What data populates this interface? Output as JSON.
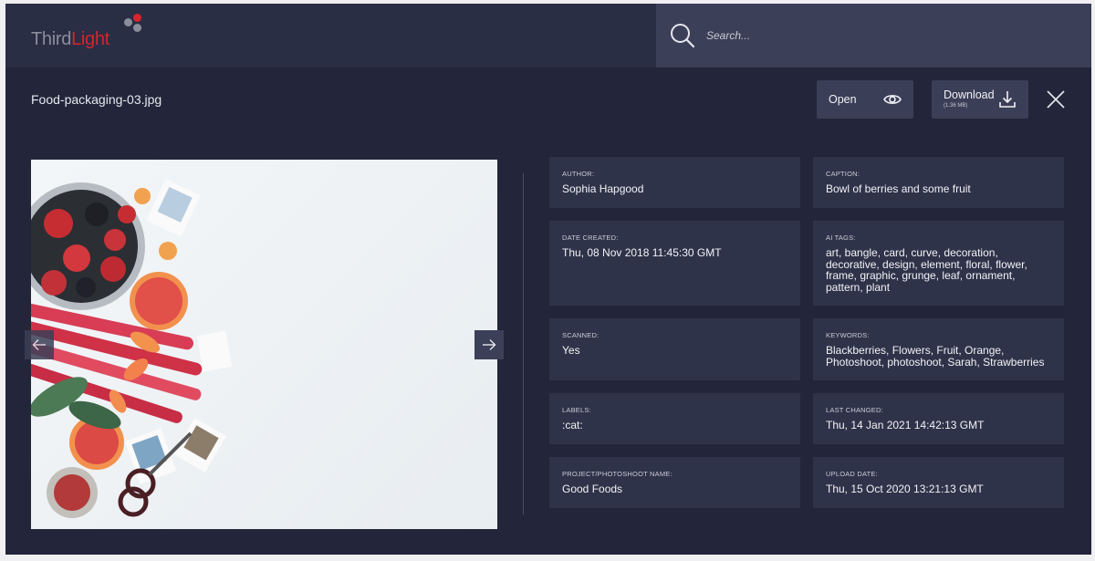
{
  "brand": {
    "logo_part1": "Third",
    "logo_part2": "Light",
    "colors": {
      "accent_red": "#d8242c",
      "dot_gray": "#8a8d9c"
    }
  },
  "search": {
    "placeholder": "Search...",
    "value": ""
  },
  "file": {
    "title": "Food-packaging-03.jpg",
    "open_label": "Open",
    "download_label": "Download",
    "download_size": "(1.36 MB)"
  },
  "icons": {
    "search": "search-icon",
    "open": "eye-icon",
    "download": "download-icon",
    "close": "close-icon",
    "prev": "arrow-left-icon",
    "next": "arrow-right-icon"
  },
  "metadata": {
    "author": {
      "label": "AUTHOR:",
      "value": "Sophia Hapgood"
    },
    "caption": {
      "label": "CAPTION:",
      "value": "Bowl of berries and some fruit"
    },
    "date_created": {
      "label": "DATE CREATED:",
      "value": "Thu, 08 Nov 2018 11:45:30 GMT"
    },
    "ai_tags": {
      "label": "AI TAGS:",
      "value": "art, bangle, card, curve, decoration, decorative, design, element, floral, flower, frame, graphic, grunge, leaf, ornament, pattern, plant"
    },
    "scanned": {
      "label": "SCANNED:",
      "value": "Yes"
    },
    "keywords": {
      "label": "KEYWORDS:",
      "value": "Blackberries, Flowers, Fruit, Orange, Photoshoot, photoshoot, Sarah, Strawberries"
    },
    "labels": {
      "label": "LABELS:",
      "value": ":cat:"
    },
    "last_changed": {
      "label": "LAST CHANGED:",
      "value": "Thu, 14 Jan 2021 14:42:13 GMT"
    },
    "project": {
      "label": "PROJECT/PHOTOSHOOT NAME:",
      "value": "Good Foods"
    },
    "upload_date": {
      "label": "UPLOAD DATE:",
      "value": "Thu, 15 Oct 2020 13:21:13 GMT"
    }
  }
}
